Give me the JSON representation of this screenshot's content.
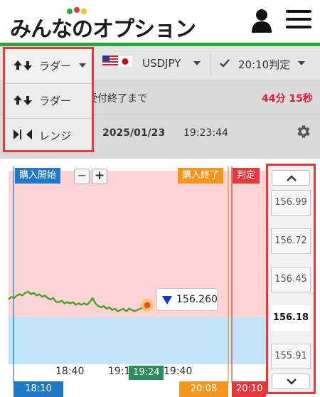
{
  "header": {
    "logo_text": "みんなのオプション"
  },
  "selectors": {
    "type_label": "ラダー",
    "pair_label": "USDJPY",
    "deadline_label": "20:10判定"
  },
  "dropdown": {
    "items": [
      {
        "label": "ラダー",
        "icon": "up-down-arrows-icon"
      },
      {
        "label": "レンジ",
        "icon": "range-arrows-icon"
      }
    ]
  },
  "info": {
    "countdown_label": "受付終了まで",
    "countdown_value": "44分 15秒",
    "date": "2025/01/23",
    "time": "19:23:44"
  },
  "chart": {
    "tags": {
      "start_label": "購入開始",
      "end_label": "購入終了",
      "judge_label": "判定",
      "start_time": "18:10",
      "end_time": "20:08",
      "judge_time": "20:10"
    },
    "current_price": "156.260",
    "current_time": "19:24",
    "x_ticks": [
      "18:40",
      "19:1",
      "19:40"
    ]
  },
  "ladder": {
    "prices": [
      "156.99",
      "156.72",
      "156.45",
      "156.18",
      "155.91"
    ],
    "current": "156.18"
  },
  "colors": {
    "accent_red": "#e8373b",
    "green": "#2aa838",
    "blue": "#1f78c8",
    "orange": "#f7941d",
    "pink_zone": "#fcd4d6",
    "blue_zone": "#bfe3f7"
  },
  "chart_data": {
    "type": "line",
    "series": [
      {
        "values": [
          156.24,
          156.26,
          156.25,
          156.27,
          156.28,
          156.27,
          156.29,
          156.3,
          156.28,
          156.29,
          156.27,
          156.28,
          156.26,
          156.27,
          156.25,
          156.24,
          156.25,
          156.22,
          156.22,
          156.23,
          156.21,
          156.22,
          156.21,
          156.22,
          156.2,
          156.21,
          156.2,
          156.21,
          156.2,
          156.22,
          156.25,
          156.21,
          156.19,
          156.18,
          156.19,
          156.17,
          156.18,
          156.16,
          156.17,
          156.15,
          156.16,
          156.17,
          156.15,
          156.17,
          156.16,
          156.15,
          156.16,
          156.17,
          156.18,
          156.16
        ]
      }
    ],
    "ylim": [
      155.79,
      157.07
    ]
  }
}
